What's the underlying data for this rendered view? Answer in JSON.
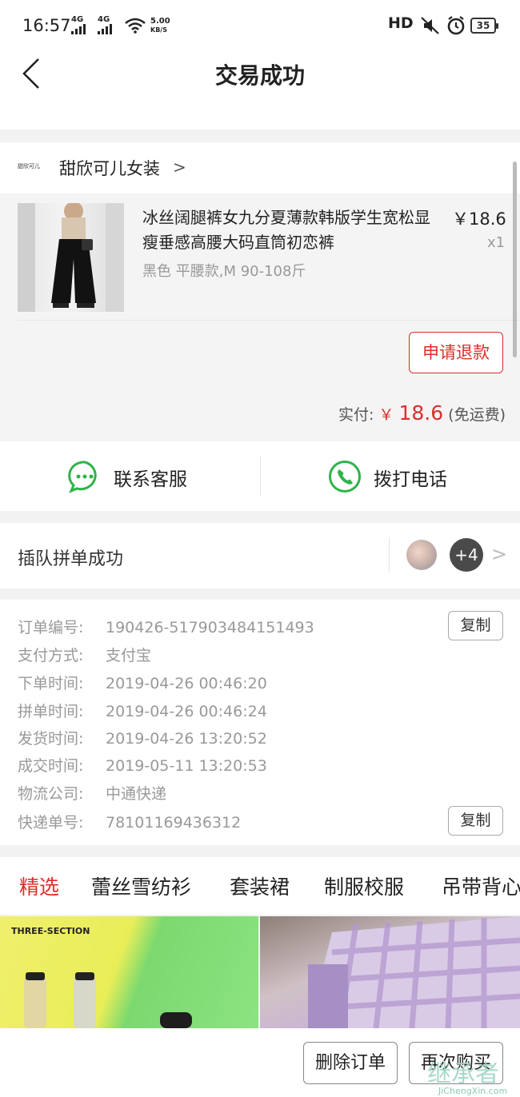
{
  "status_bar": {
    "time": "16:57",
    "signal1": "4G",
    "signal2": "4G",
    "net_speed_value": "5.00",
    "net_speed_unit": "KB/S",
    "hd": "HD",
    "battery": "35"
  },
  "nav": {
    "title": "交易成功"
  },
  "shop": {
    "logo_text": "甜欣可儿",
    "name": "甜欣可儿女装"
  },
  "product": {
    "title": "冰丝阔腿裤女九分夏薄款韩版学生宽松显瘦垂感高腰大码直筒初恋裤",
    "spec": "黑色 平腰款,M 90-108斤",
    "price": "￥18.6",
    "quantity": "x1",
    "refund_label": "申请退款"
  },
  "payment": {
    "label": "实付:",
    "currency": "￥",
    "amount": "18.6",
    "note": "(免运费)"
  },
  "contact": {
    "service_label": "联系客服",
    "phone_label": "拨打电话"
  },
  "group": {
    "label": "插队拼单成功",
    "more_count": "+4"
  },
  "order_info": {
    "copy_label": "复制",
    "rows": [
      {
        "key": "订单编号:",
        "value": "190426-517903484151493"
      },
      {
        "key": "支付方式:",
        "value": "支付宝"
      },
      {
        "key": "下单时间:",
        "value": "2019-04-26 00:46:20"
      },
      {
        "key": "拼单时间:",
        "value": "2019-04-26 00:46:24"
      },
      {
        "key": "发货时间:",
        "value": "2019-04-26 13:20:52"
      },
      {
        "key": "成交时间:",
        "value": "2019-05-11 13:20:53"
      },
      {
        "key": "物流公司:",
        "value": "中通快递"
      },
      {
        "key": "快递单号:",
        "value": "78101169436312"
      }
    ]
  },
  "tabs": [
    "精选",
    "蕾丝雪纺衫",
    "套装裙",
    "制服校服",
    "吊带背心"
  ],
  "grid": {
    "tile1_text": "THREE-SECTION"
  },
  "bottom": {
    "delete_label": "删除订单",
    "rebuy_label": "再次购买"
  },
  "watermark": {
    "text": "继承者",
    "sub": "JiChengXin.com"
  },
  "colors": {
    "accent_red": "#d9302a",
    "icon_green": "#2fb34a"
  }
}
